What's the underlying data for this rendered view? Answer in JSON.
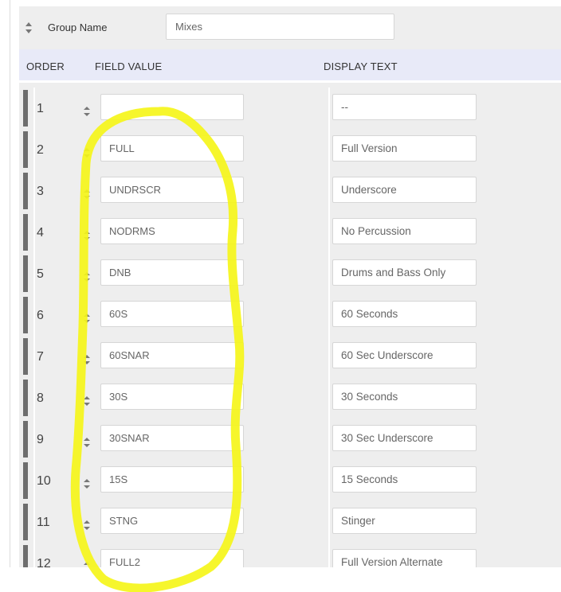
{
  "group": {
    "label": "Group Name",
    "value": "Mixes"
  },
  "header": {
    "order": "ORDER",
    "field_value": "FIELD VALUE",
    "display_text": "DISPLAY TEXT"
  },
  "rows": [
    {
      "order": "1",
      "field": "",
      "display": "--"
    },
    {
      "order": "2",
      "field": "FULL",
      "display": "Full Version"
    },
    {
      "order": "3",
      "field": "UNDRSCR",
      "display": "Underscore"
    },
    {
      "order": "4",
      "field": "NODRMS",
      "display": "No Percussion"
    },
    {
      "order": "5",
      "field": "DNB",
      "display": "Drums and Bass Only"
    },
    {
      "order": "6",
      "field": "60S",
      "display": "60 Seconds"
    },
    {
      "order": "7",
      "field": "60SNAR",
      "display": "60 Sec Underscore"
    },
    {
      "order": "8",
      "field": "30S",
      "display": "30 Seconds"
    },
    {
      "order": "9",
      "field": "30SNAR",
      "display": "30 Sec Underscore"
    },
    {
      "order": "10",
      "field": "15S",
      "display": "15 Seconds"
    },
    {
      "order": "11",
      "field": "STNG",
      "display": "Stinger"
    },
    {
      "order": "12",
      "field": "FULL2",
      "display": "Full Version Alternate"
    }
  ],
  "colors": {
    "panel_bg": "#eeeeee",
    "header_bg": "#e8eaf8",
    "drag_bar": "#6e6e6e",
    "highlight": "#f5f51a"
  },
  "icons": {
    "sort": "sort-arrows-icon",
    "drag": "drag-handle-bar"
  }
}
